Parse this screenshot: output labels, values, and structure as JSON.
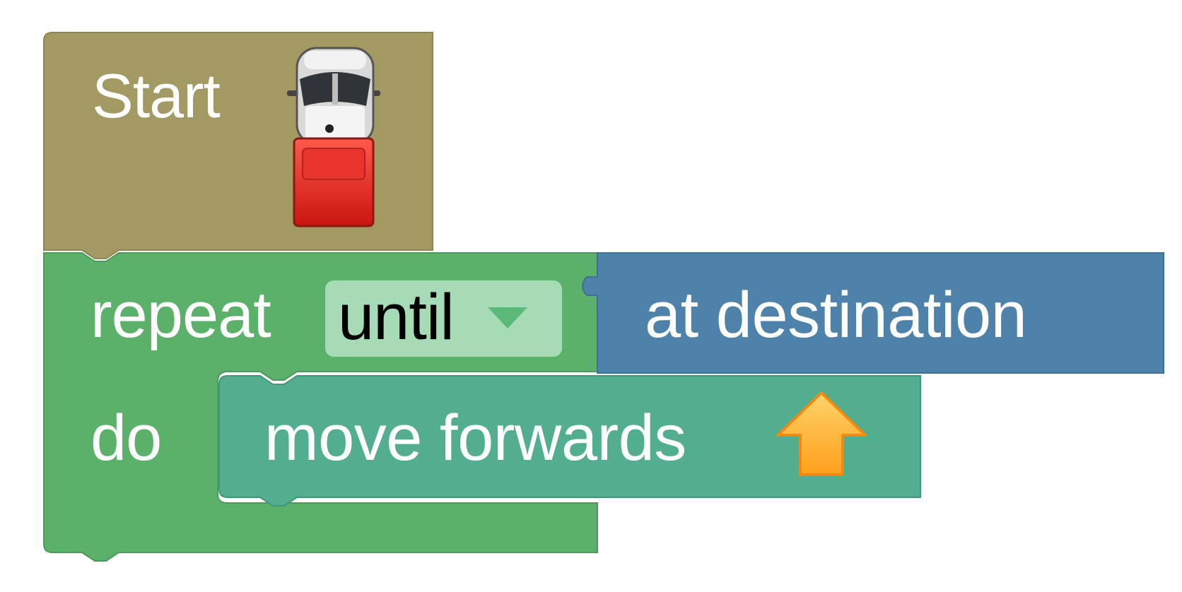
{
  "blocks": {
    "start": {
      "label": "Start",
      "color": "#a29963",
      "icon": "van-icon"
    },
    "repeat": {
      "label": "repeat",
      "do_label": "do",
      "color": "#5bb06a",
      "mode": {
        "selected": "until",
        "color": "#a6dbb8"
      }
    },
    "condition": {
      "label": "at destination",
      "color": "#4e82aa"
    },
    "move": {
      "label": "move forwards",
      "color": "#52ae8e",
      "icon": "arrow-up-icon",
      "icon_color": "#ffb02e"
    }
  }
}
